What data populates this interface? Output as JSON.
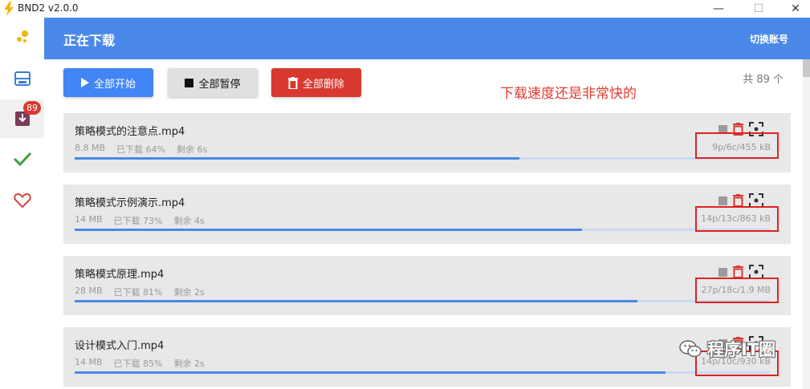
{
  "window": {
    "title": "BND2 v2.0.0",
    "minimize_label": "—",
    "maximize_label": "☐",
    "close_label": "✕"
  },
  "sidebar": {
    "items": [
      {
        "name": "logo",
        "icon": "dots-logo-icon"
      },
      {
        "name": "inbox",
        "icon": "inbox-icon"
      },
      {
        "name": "downloading",
        "icon": "download-tray-icon",
        "badge": "89",
        "active": true
      },
      {
        "name": "completed",
        "icon": "checkmark-icon"
      },
      {
        "name": "favorites",
        "icon": "heart-icon"
      }
    ]
  },
  "header": {
    "title": "正在下载",
    "switch_account": "切换账号"
  },
  "toolbar": {
    "start_all": "全部开始",
    "pause_all": "全部暂停",
    "delete_all": "全部删除"
  },
  "annotation": "下载速度还是非常快的",
  "total_count": "共 89 个",
  "tasks": [
    {
      "name": "策略模式的注意点.mp4",
      "size": "8.8 MB",
      "downloaded": "已下载 64%",
      "remaining": "剩余 6s",
      "speed": "9p/6c/455 kB",
      "progress": 0.64
    },
    {
      "name": "策略模式示例演示.mp4",
      "size": "14 MB",
      "downloaded": "已下载 73%",
      "remaining": "剩余 4s",
      "speed": "14p/13c/863 kB",
      "progress": 0.73
    },
    {
      "name": "策略模式原理.mp4",
      "size": "28 MB",
      "downloaded": "已下载 81%",
      "remaining": "剩余 2s",
      "speed": "27p/18c/1.9 MB",
      "progress": 0.81
    },
    {
      "name": "设计模式入门.mp4",
      "size": "14 MB",
      "downloaded": "已下载 85%",
      "remaining": "剩余 2s",
      "speed": "14p/10c/930 kB",
      "progress": 0.85
    }
  ],
  "watermark": "程序IT圈",
  "colors": {
    "header": "#4a89e8",
    "start_button": "#4285f4",
    "pause_button": "#e0e0e0",
    "delete_button": "#d9382f",
    "badge": "#d73a36",
    "annotation": "#e23b32",
    "highlight_box": "#e02222"
  }
}
